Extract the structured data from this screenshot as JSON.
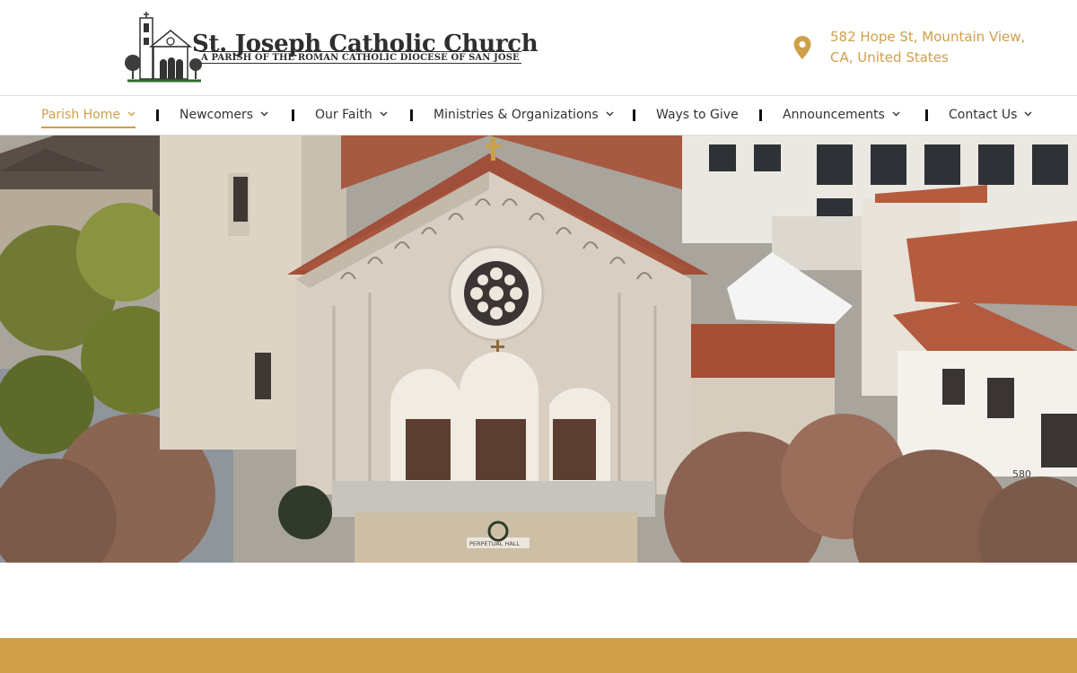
{
  "brand": {
    "title": "St. Joseph Catholic Church",
    "subtitle": "A PARISH OF THE ROMAN CATHOLIC DIOCESE OF SAN JOSE"
  },
  "address": {
    "icon": "location-pin-icon",
    "line1": "582 Hope St, Mountain View,",
    "line2": "CA, United States"
  },
  "nav": {
    "items": [
      {
        "label": "Parish Home",
        "has_dropdown": true,
        "active": true
      },
      {
        "label": "Newcomers",
        "has_dropdown": true
      },
      {
        "label": "Our Faith",
        "has_dropdown": true
      },
      {
        "label": "Ministries & Organizations",
        "has_dropdown": true
      },
      {
        "label": "Ways to Give",
        "has_dropdown": false
      },
      {
        "label": "Announcements",
        "has_dropdown": true
      },
      {
        "label": "Contact Us",
        "has_dropdown": true
      }
    ]
  },
  "hero": {
    "building_number": "580",
    "plaque": "PERPETUAL HALL"
  },
  "colors": {
    "accent": "#cf9f4a",
    "footer": "#d09e46",
    "text": "#333333"
  }
}
